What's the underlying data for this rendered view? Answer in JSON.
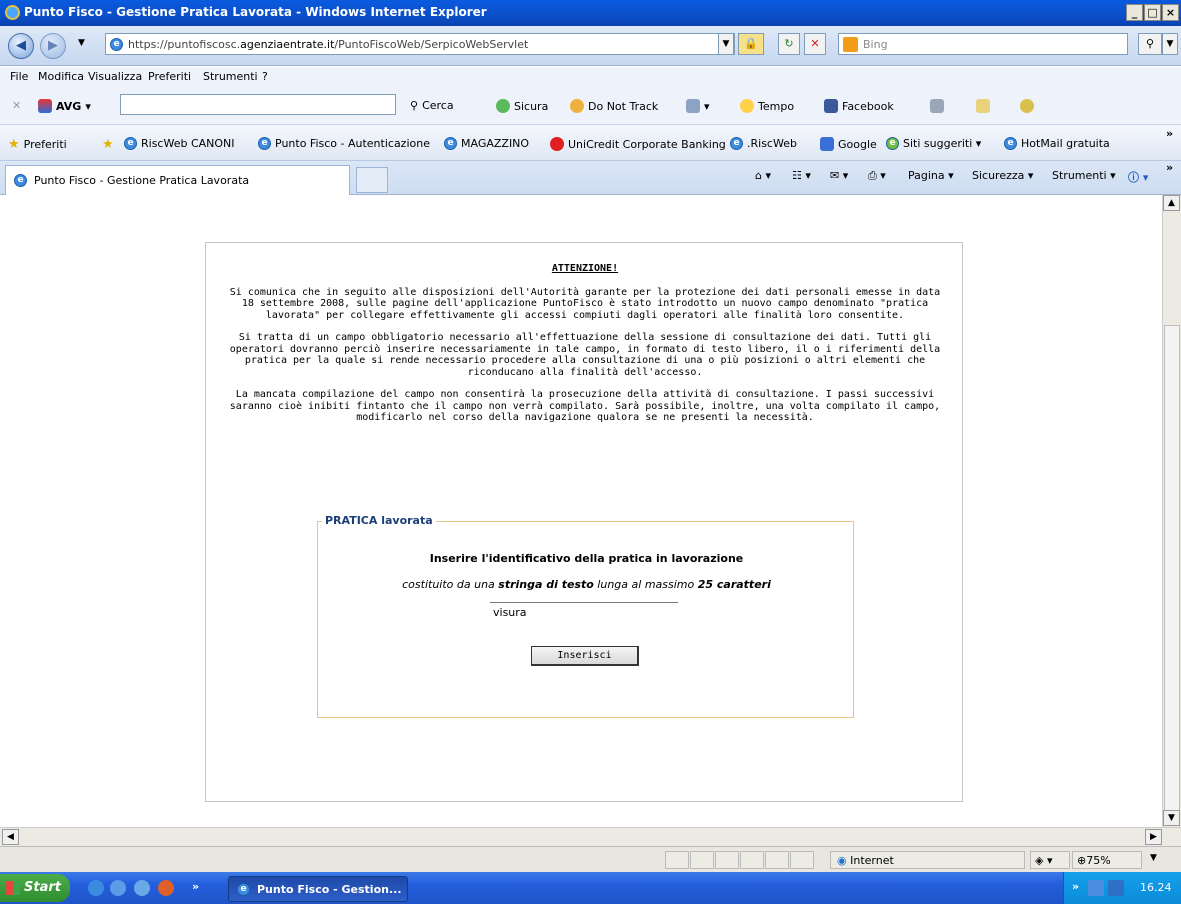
{
  "window": {
    "title": "Punto Fisco - Gestione Pratica Lavorata - Windows Internet Explorer",
    "controls": [
      "_",
      "□",
      "×"
    ]
  },
  "address": {
    "url_prefix": "https://puntofiscosc.",
    "url_host": "agenziaentrate.it",
    "url_path": "/PuntoFiscoWeb/SerpicoWebServlet",
    "search_placeholder": "Bing"
  },
  "menu": [
    "File",
    "Modifica",
    "Visualizza",
    "Preferiti",
    "Strumenti",
    "?"
  ],
  "avg_toolbar": {
    "brand": "AVG",
    "search_button": "Cerca",
    "safe": "Sicura",
    "dnt": "Do Not Track",
    "weather": "Tempo",
    "facebook": "Facebook"
  },
  "favorites": {
    "label": "Preferiti",
    "items": [
      "RiscWeb CANONI",
      "Punto Fisco - Autenticazione",
      "MAGAZZINO",
      "UniCredit Corporate Banking",
      ".RiscWeb",
      "Google",
      "Siti suggeriti ▾",
      "HotMail gratuita"
    ]
  },
  "tab": {
    "title": "Punto Fisco - Gestione Pratica Lavorata"
  },
  "command_bar": {
    "page": "Pagina ▾",
    "security": "Sicurezza ▾",
    "tools": "Strumenti ▾"
  },
  "notice": {
    "title": "ATTENZIONE!",
    "p1": "Si comunica che in seguito alle disposizioni dell'Autorità garante per la protezione dei dati personali emesse in data 18 settembre 2008, sulle pagine dell'applicazione PuntoFisco è stato introdotto un nuovo campo denominato \"pratica lavorata\" per collegare effettivamente gli accessi compiuti dagli operatori alle finalità loro consentite.",
    "p2": "Si tratta di un campo obbligatorio necessario all'effettuazione della sessione di consultazione dei dati. Tutti gli operatori dovranno perciò inserire necessariamente in tale campo, in formato di testo libero, il o i riferimenti della pratica per la quale si rende necessario procedere alla consultazione di una o più posizioni o altri elementi che riconducano alla finalità dell'accesso.",
    "p3": "La mancata compilazione del campo non consentirà la prosecuzione della attività di consultazione. I passi successivi saranno cioè inibiti fintanto che il campo non verrà compilato. Sarà possibile, inoltre, una volta compilato il campo, modificarlo nel corso della navigazione qualora se ne presenti la necessità."
  },
  "form": {
    "legend": "PRATICA lavorata",
    "instruction": "Inserire l'identificativo della pratica in lavorazione",
    "hint_a": "costituito da una ",
    "hint_b": "stringa di testo",
    "hint_c": " lunga al massimo ",
    "hint_d": "25 caratteri",
    "value": "visura",
    "button": "Inserisci"
  },
  "status": {
    "zone": "Internet",
    "zoom": "75%"
  },
  "taskbar": {
    "start": "Start",
    "task": "Punto Fisco - Gestion...",
    "clock": "16.24",
    "chevron": "»"
  },
  "colors": {
    "titlebar": "#0b4fc9",
    "legend": "#1b3f78",
    "fieldset_border": "#e8c489"
  }
}
